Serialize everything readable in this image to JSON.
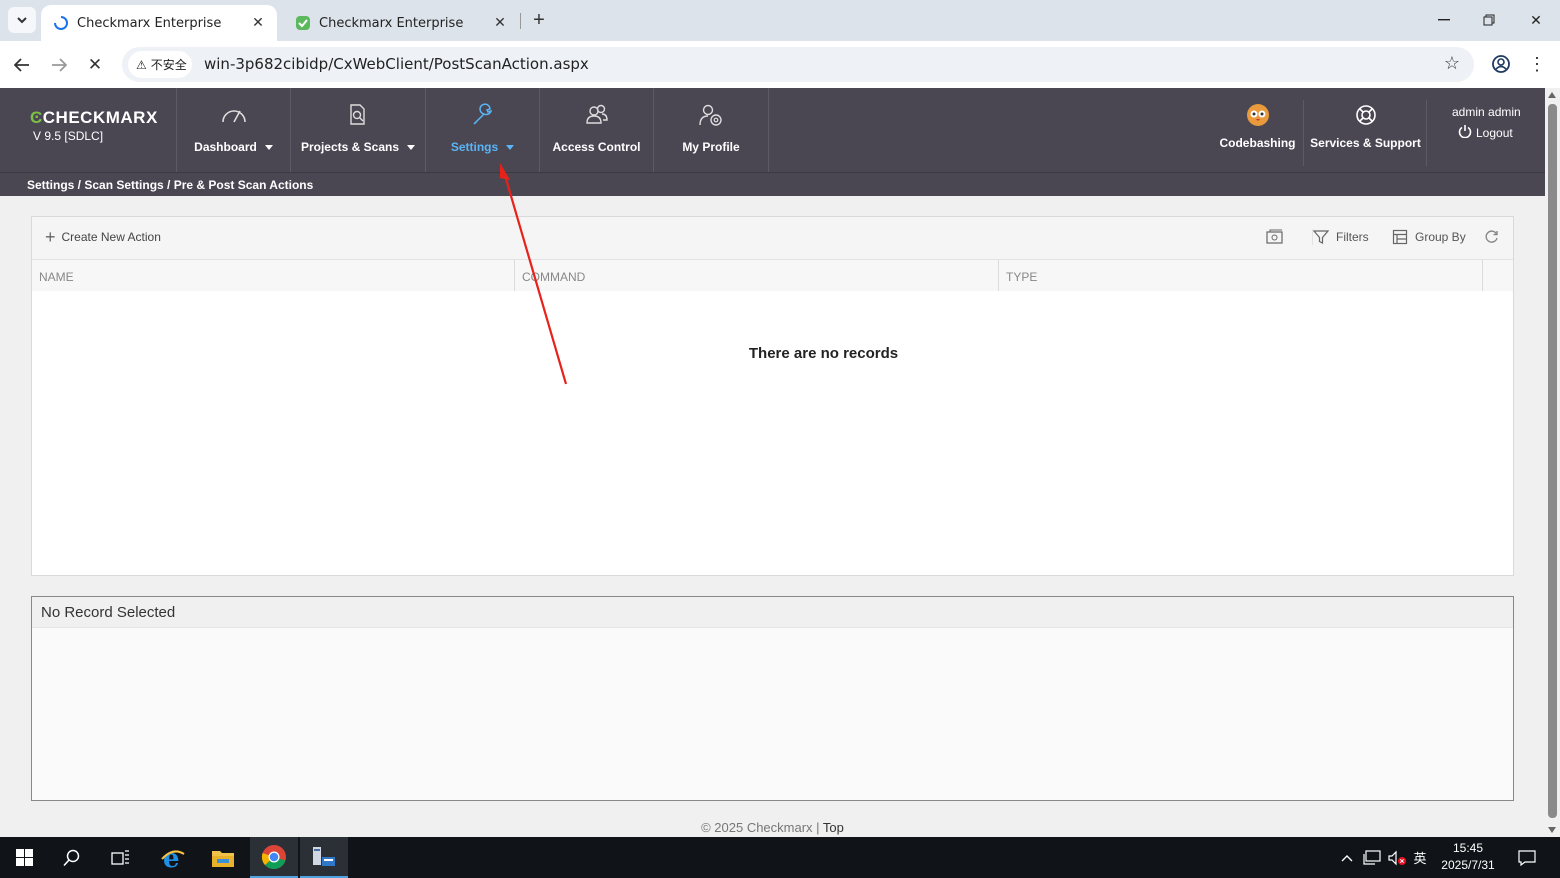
{
  "browser": {
    "tabs": [
      {
        "title": "Checkmarx Enterprise",
        "state": "loading"
      },
      {
        "title": "Checkmarx Enterprise",
        "state": "loaded"
      }
    ],
    "security_label": "不安全",
    "url": "win-3p682cibidp/CxWebClient/PostScanAction.aspx"
  },
  "app": {
    "logo": "CHECKMARX",
    "version": "V 9.5  [SDLC]",
    "nav": [
      {
        "label": "Dashboard",
        "icon": "speedometer-icon",
        "dropdown": true
      },
      {
        "label": "Projects & Scans",
        "icon": "document-search-icon",
        "dropdown": true
      },
      {
        "label": "Settings",
        "icon": "wrench-icon",
        "dropdown": true,
        "active": true
      },
      {
        "label": "Access Control",
        "icon": "users-icon",
        "dropdown": false
      },
      {
        "label": "My Profile",
        "icon": "user-gear-icon",
        "dropdown": false
      }
    ],
    "right": {
      "codebashing": "Codebashing",
      "services": "Services & Support",
      "user": "admin admin",
      "logout": "Logout"
    },
    "breadcrumb": "Settings / Scan Settings / Pre & Post Scan Actions",
    "active_color": "#5ab4f5",
    "header_color": "#4a4753"
  },
  "grid": {
    "create_label": "Create New Action",
    "filters_label": "Filters",
    "groupby_label": "Group By",
    "columns": [
      "NAME",
      "COMMAND",
      "TYPE"
    ],
    "empty_message": "There are no records"
  },
  "detail": {
    "title": "No Record Selected"
  },
  "footer": {
    "copyright": "© 2025 Checkmarx | ",
    "top_link": "Top"
  },
  "taskbar": {
    "time": "15:45",
    "date": "2025/7/31",
    "ime": "英"
  }
}
